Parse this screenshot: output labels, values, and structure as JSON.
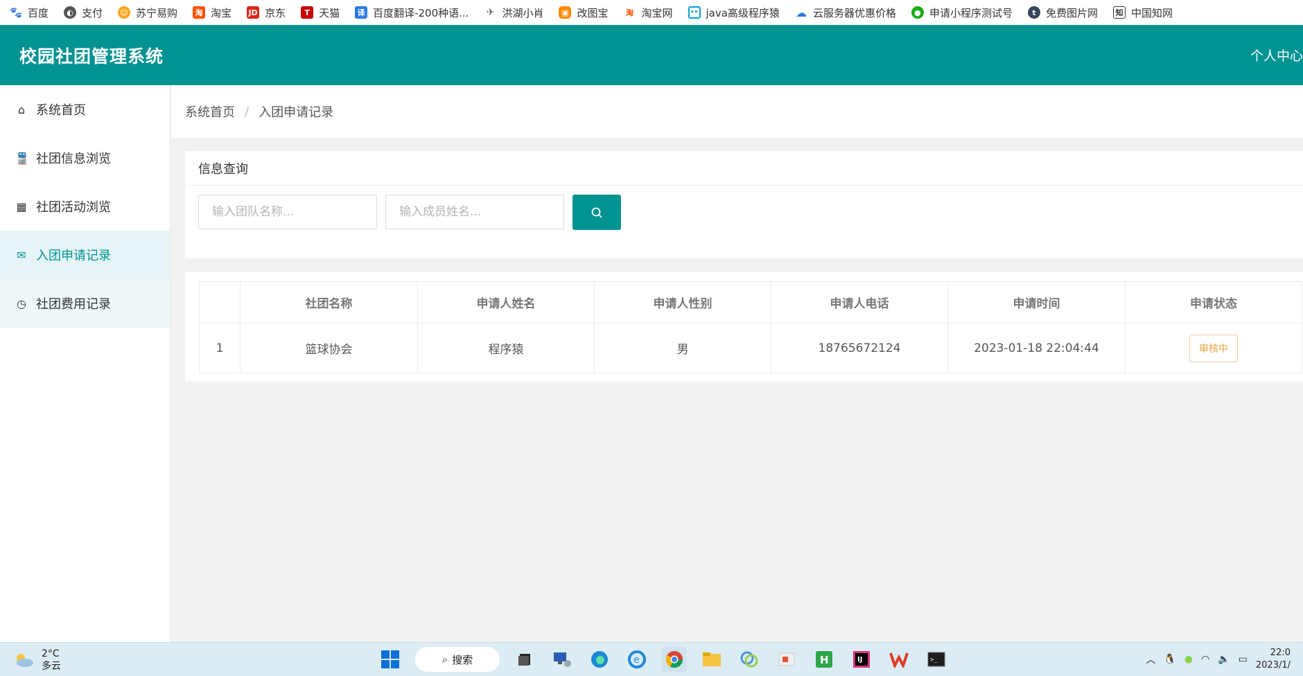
{
  "bookmarks": [
    {
      "label": "百度",
      "icon": "baidu-paw-icon",
      "color": "#2a53e0"
    },
    {
      "label": "支付",
      "icon": "globe-icon",
      "color": "#555555"
    },
    {
      "label": "苏宁易购",
      "icon": "suning-lion-icon",
      "color": "#f5a623"
    },
    {
      "label": "淘宝",
      "icon": "taobao-icon",
      "color": "#ff5000"
    },
    {
      "label": "京东",
      "icon": "jd-icon",
      "color": "#e1251b"
    },
    {
      "label": "天猫",
      "icon": "tmall-icon",
      "color": "#c40000"
    },
    {
      "label": "百度翻译-200种语...",
      "icon": "translate-icon",
      "color": "#2a7ae2"
    },
    {
      "label": "洪湖小肖",
      "icon": "bird-icon",
      "color": "#666666"
    },
    {
      "label": "改图宝",
      "icon": "gaitubao-icon",
      "color": "#ff8a00"
    },
    {
      "label": "淘宝网",
      "icon": "taobao-icon",
      "color": "#ff5000"
    },
    {
      "label": "java高级程序猿",
      "icon": "bilibili-icon",
      "color": "#00a1d6"
    },
    {
      "label": "云服务器优惠价格",
      "icon": "cloud-icon",
      "color": "#2a7ae2"
    },
    {
      "label": "申请小程序测试号",
      "icon": "wechat-icon",
      "color": "#1aad19"
    },
    {
      "label": "免费图片网",
      "icon": "tumblr-icon",
      "color": "#35465c"
    },
    {
      "label": "中国知网",
      "icon": "cnki-icon",
      "color": "#333333"
    }
  ],
  "header": {
    "title": "校园社团管理系统",
    "user_menu": "个人中心"
  },
  "sidebar": {
    "items": [
      {
        "label": "系统首页",
        "icon": "home-icon",
        "active": false
      },
      {
        "label": "社团信息浏览",
        "icon": "train-icon",
        "active": false
      },
      {
        "label": "社团活动浏览",
        "icon": "calculator-icon",
        "active": false
      },
      {
        "label": "入团申请记录",
        "icon": "envelope-open-icon",
        "active": true
      },
      {
        "label": "社团费用记录",
        "icon": "clock-icon",
        "active": false
      }
    ]
  },
  "breadcrumb": {
    "home": "系统首页",
    "separator": "/",
    "current": "入团申请记录"
  },
  "query": {
    "title": "信息查询",
    "team_placeholder": "输入团队名称...",
    "member_placeholder": "输入成员姓名...",
    "search_icon": "search-icon"
  },
  "table": {
    "headers": [
      "",
      "社团名称",
      "申请人姓名",
      "申请人性别",
      "申请人电话",
      "申请时间",
      "申请状态"
    ],
    "rows": [
      {
        "index": "1",
        "club": "篮球协会",
        "name": "程序猿",
        "gender": "男",
        "phone": "18765672124",
        "time": "2023-01-18 22:04:44",
        "status": "审核中"
      }
    ]
  },
  "taskbar": {
    "temperature": "2°C",
    "weather": "多云",
    "search_label": "搜索",
    "time": "22:0",
    "date": "2023/1/"
  },
  "colors": {
    "primary": "#009392",
    "active_bg": "#e6f4f7",
    "status_text": "#e6a23c"
  }
}
